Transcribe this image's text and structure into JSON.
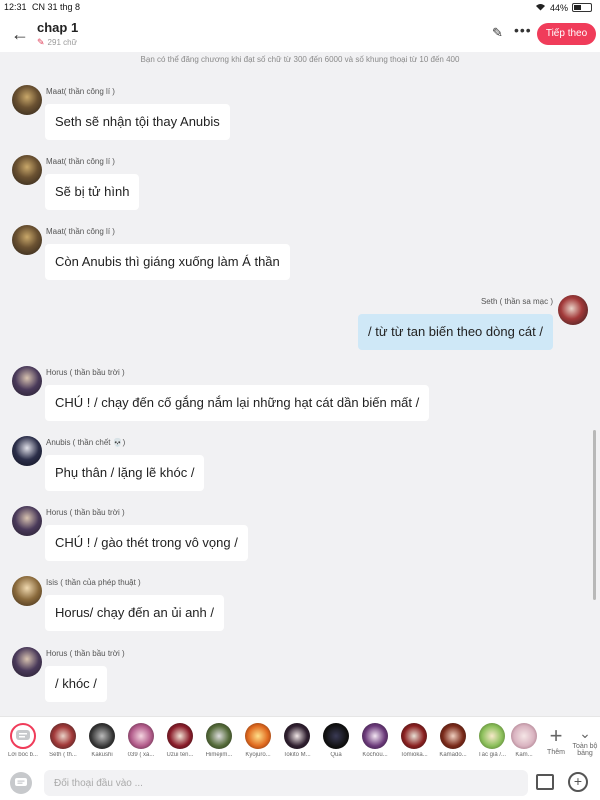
{
  "status": {
    "time": "12:31",
    "date": "CN 31 thg 8",
    "battery": "44%"
  },
  "header": {
    "title": "chap 1",
    "word_count": "291 chữ",
    "next_label": "Tiếp theo"
  },
  "notice": "Bạn có thể đăng chương khi đạt số chữ từ 300 đến 6000 và số khung thoại từ 10 đến 400",
  "messages": [
    {
      "sender": "Maat( thần công lí )",
      "text": "Seth sẽ nhận tội thay Anubis"
    },
    {
      "sender": "Maat( thần công lí )",
      "text": "Sẽ bị tử hình"
    },
    {
      "sender": "Maat( thần công lí )",
      "text": "Còn Anubis thì giáng xuống làm Á thần"
    },
    {
      "sender": "Seth ( thần sa mạc )",
      "text": "/ từ từ tan biến theo dòng cát /"
    },
    {
      "sender": "Horus ( thần bầu trời )",
      "text": "CHÚ ! / chạy đến cố gắng nắm lại những hạt cát dần biến mất /"
    },
    {
      "sender": "Anubis ( thần chết 💀)",
      "text": "Phụ thân / lặng lẽ khóc /"
    },
    {
      "sender": "Horus ( thần bầu trời )",
      "text": "CHÚ ! / gào thét trong vô vọng /"
    },
    {
      "sender": "Isis ( thần của phép thuật )",
      "text": "Horus/ chạy đến an ủi anh /"
    },
    {
      "sender": "Horus ( thần bầu trời )",
      "text": "/ khóc /"
    }
  ],
  "characters": [
    {
      "label": "Lời bốc b..."
    },
    {
      "label": "Seth ( th..."
    },
    {
      "label": "Kakushi"
    },
    {
      "label": "039 ( xá..."
    },
    {
      "label": "Uzui ten..."
    },
    {
      "label": "Himejim..."
    },
    {
      "label": "Kyojuro..."
    },
    {
      "label": "Tokito M..."
    },
    {
      "label": "Qua"
    },
    {
      "label": "Kochou..."
    },
    {
      "label": "Tomioka..."
    },
    {
      "label": "Kamado..."
    },
    {
      "label": "Tác giả /..."
    },
    {
      "label": "Kam..."
    }
  ],
  "add_character_label": "Thêm",
  "expand_label": "Toàn bộ bảng",
  "input": {
    "placeholder": "Đối thoại đầu vào ..."
  },
  "colors": {
    "accent": "#f03c5a",
    "right_bubble": "#cfe8f7",
    "background": "#f1f1f3"
  }
}
